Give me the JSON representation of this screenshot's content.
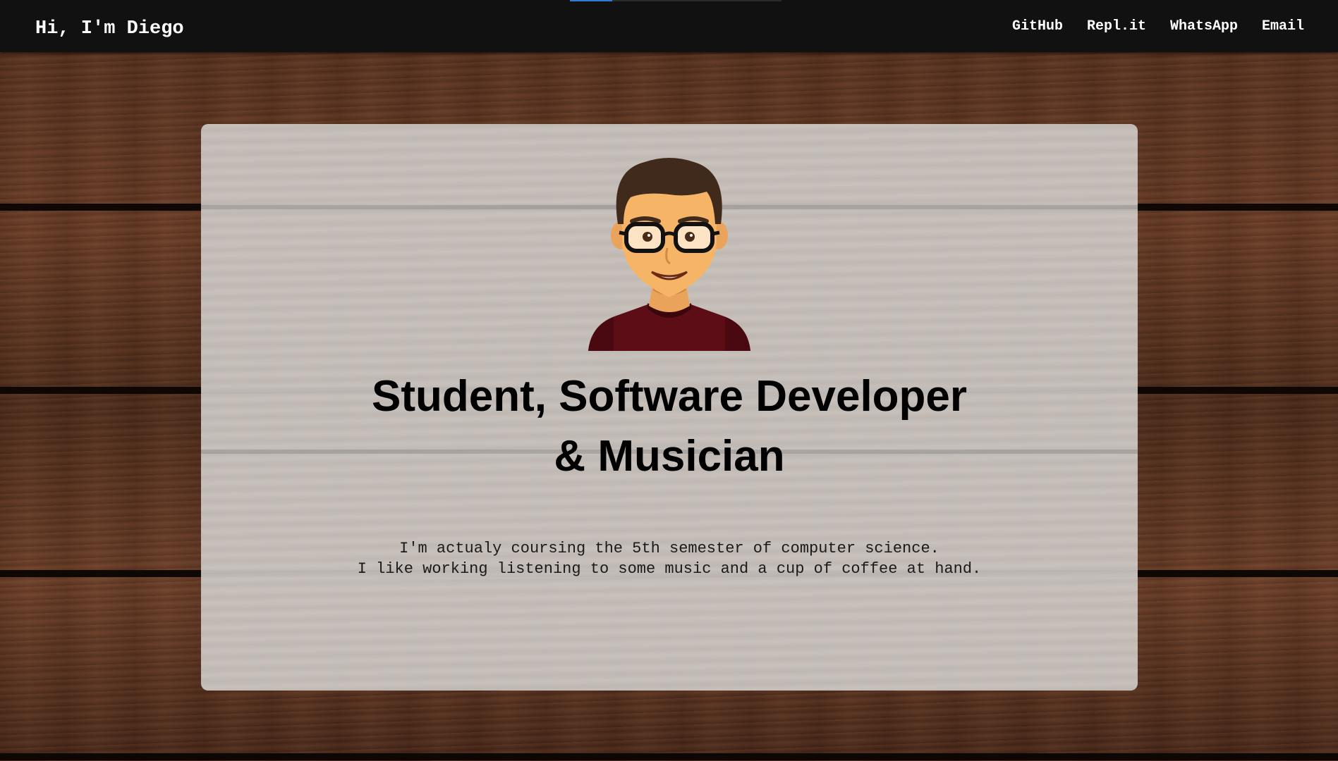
{
  "navbar": {
    "brand": "Hi, I'm Diego",
    "progress": 0.2,
    "links": [
      {
        "label": "GitHub"
      },
      {
        "label": "Repl.it"
      },
      {
        "label": "WhatsApp"
      },
      {
        "label": "Email"
      }
    ]
  },
  "hero": {
    "headline_line1": "Student, Software Developer",
    "headline_line2": "& Musician",
    "description_line1": "I'm actualy coursing the 5th semester of computer science.",
    "description_line2": "I like working listening to some music and a cup of coffee at hand."
  },
  "colors": {
    "navbar_bg": "#111111",
    "progress_accent": "#2f7bd6",
    "card_bg": "#cdc8c4",
    "text": "#000000"
  },
  "icons": {
    "avatar": "developer-avatar-illustration"
  }
}
